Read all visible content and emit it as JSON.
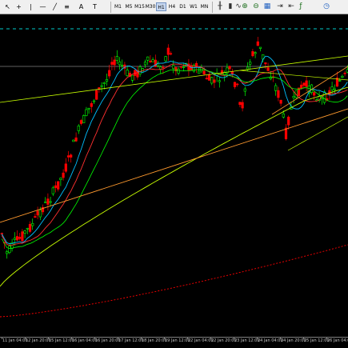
{
  "toolbar": {
    "timeframes": [
      "M1",
      "M5",
      "M15",
      "M30",
      "H1",
      "H4",
      "D1",
      "W1",
      "MN"
    ],
    "active_timeframe": "H1",
    "tools": [
      "cursor-icon",
      "crosshair-icon",
      "vertical-line-icon",
      "horizontal-line-icon",
      "trendline-icon",
      "channel-icon",
      "text-icon",
      "label-icon"
    ],
    "chart_tools": [
      "bar-chart-icon",
      "candle-chart-icon",
      "line-chart-icon",
      "zoom-in-icon",
      "zoom-out-icon",
      "tile-icon",
      "autoscroll-icon",
      "chart-shift-icon",
      "indicators-icon",
      "periods-icon"
    ]
  },
  "axis": {
    "time_labels": [
      "11 Jan 04:00",
      "12 Jan 20:00",
      "15 Jan 12:00",
      "16 Jan 04:00",
      "16 Jan 20:00",
      "17 Jan 12:00",
      "18 Jan 20:00",
      "19 Jan 12:00",
      "22 Jan 04:00",
      "22 Jan 20:00",
      "23 Jan 12:00",
      "24 Jan 04:00",
      "24 Jan 20:00",
      "25 Jan 12:00",
      "26 Jan 04:00"
    ]
  },
  "colors": {
    "bull": "#00ff00",
    "bear": "#ff0000",
    "ma_fast": "#00bfff",
    "ma_mid": "#ff3030",
    "ma_slow": "#c8ff00",
    "trend_orange": "#ff9a2e",
    "dotted_red": "#ff0000",
    "dashed_cyan": "#00c8c8",
    "grey_h": "#808080"
  }
}
